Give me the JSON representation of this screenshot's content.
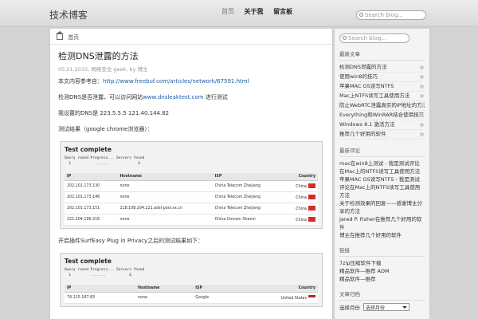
{
  "header": {
    "site_title": "技术博客",
    "nav": [
      "首页",
      "关于我",
      "留言板"
    ],
    "search_placeholder": "Search blog..."
  },
  "breadcrumb": {
    "label": "首页"
  },
  "post": {
    "title": "检测DNS泄露的方法",
    "meta": "05.21.2015, 网络安全 geek, by 博主",
    "p1_text": "本文内容参考自：",
    "p1_link": "http://www.freebuf.com/articles/network/67591.html",
    "p2_text": "检测DNS是否泄露，可以访问网站",
    "p2_link": "www.dnsleaktest.com",
    "p2_suffix": " 进行测试",
    "p3": "我设置的DNS是 223.5.5.5  121.40.144.82",
    "p4": "测试结果（google chrome浏览器）：",
    "p5": "开启插件SurfEasy Plug in Privacy之后的测试结果如下：",
    "shot1": {
      "title": "Test complete",
      "line1": "Query round Progress... Servers found",
      "line2": "  1           ......              4",
      "headers": [
        "IP",
        "Hostname",
        "ISP",
        "Country"
      ],
      "rows": [
        [
          "202.101.173.130",
          "none",
          "China Telecom Zhejiang",
          "China"
        ],
        [
          "202.101.173.146",
          "none",
          "China Telecom Zhejiang",
          "China"
        ],
        [
          "202.101.173.151",
          "218.108.204.221.adsl-pool.sx.cn",
          "China Telecom Zhejiang",
          "China"
        ],
        [
          "221.204.196.216",
          "none",
          "China Unicom Shanxi",
          "China"
        ]
      ]
    },
    "shot2": {
      "title": "Test complete",
      "line1": "Query round Progress... Servers found",
      "line2": "  1          ......           6",
      "headers": [
        "IP",
        "Hostname",
        "ISP",
        "Country"
      ],
      "rows": [
        [
          "74.125.187.83",
          "none",
          "Google",
          "United States"
        ]
      ]
    }
  },
  "sidebar": {
    "search_placeholder": "Search blog...",
    "recent_title": "最新文章",
    "recent": [
      "检测DNS泄露的方法",
      "使用win8的技巧",
      "苹果MAC OS读写NTFS",
      "Mac上NTFS读写工具使用方法",
      "防止WebRTC泄露真实的IP地址的方法",
      "Everything和WinRAR结合使用技巧",
      "Windows 8.1 激活方法",
      "推荐几个好用的软件"
    ],
    "comments_title": "最新评论",
    "comments": [
      "mac在win8上测试 - 我是测试评论在Mac上的NTFS读写工具使用方法",
      "苹果MAC OS读写NTFS - 我是测试评论在Mac上的NTFS读写工具使用方法",
      "关于检测效果的回复——感谢博主分享的方法",
      "Jared P. Fisher在推荐几个好用的软件",
      "博主在推荐几个好用的软件"
    ],
    "links_title": "链接",
    "links": [
      "7zip压缩软件下载",
      "精品软件—推荐 ADM",
      "精品软件—推荐"
    ],
    "archive_title": "文章归档",
    "archive_label": "选择月份",
    "archive_value": "选择月份"
  },
  "colors": {
    "link": "#1a5ea8",
    "flag_cn": "#d62d20"
  }
}
